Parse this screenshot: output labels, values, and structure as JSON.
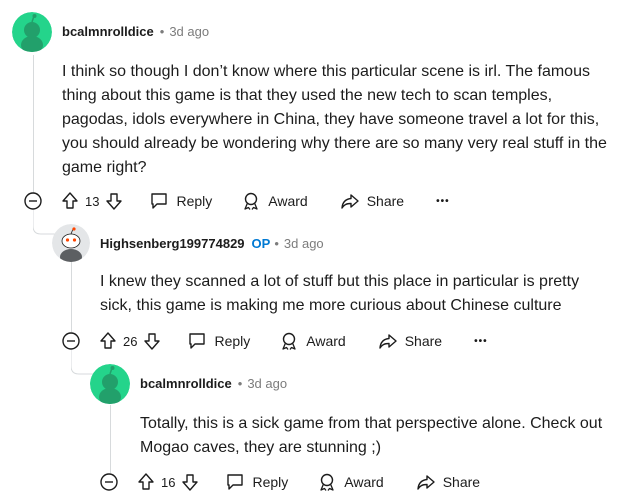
{
  "comments": [
    {
      "author": "bcalmnrolldice",
      "time": "3d ago",
      "op_badge": "",
      "body": "I think so though I don’t know where this particular scene is irl. The famous thing about this game is that they used the new tech to scan temples, pagodas, idols everywhere in China, they have someone travel a lot for this, you should already be wondering why there are so many very real stuff in the game right?",
      "votes": "13",
      "avatar_color": "#24d48b"
    },
    {
      "author": "Highsenberg199774829",
      "time": "3d ago",
      "op_badge": "OP",
      "body": "I knew they scanned a lot of stuff but this place in particular is pretty sick, this game is making me more curious about Chinese culture",
      "votes": "26",
      "avatar_color": "#e4e6e8"
    },
    {
      "author": "bcalmnrolldice",
      "time": "3d ago",
      "op_badge": "",
      "body": "Totally, this is a sick game from that perspective alone. Check out Mogao caves, they are stunning ;)",
      "votes": "16",
      "avatar_color": "#24d48b"
    }
  ],
  "actions": {
    "reply": "Reply",
    "award": "Award",
    "share": "Share",
    "more": "•••"
  },
  "separator": "•",
  "icons": {
    "collapse": "minus-circle-icon",
    "upvote": "arrow-up-icon",
    "downvote": "arrow-down-icon",
    "reply": "speech-bubble-icon",
    "award": "award-ribbon-icon",
    "share": "share-arrow-icon",
    "more": "ellipsis-icon"
  },
  "colors": {
    "op": "#0079d3",
    "muted": "#7c7c7c",
    "avatar_green": "#24d48b",
    "thread_line": "#d7dadc"
  }
}
